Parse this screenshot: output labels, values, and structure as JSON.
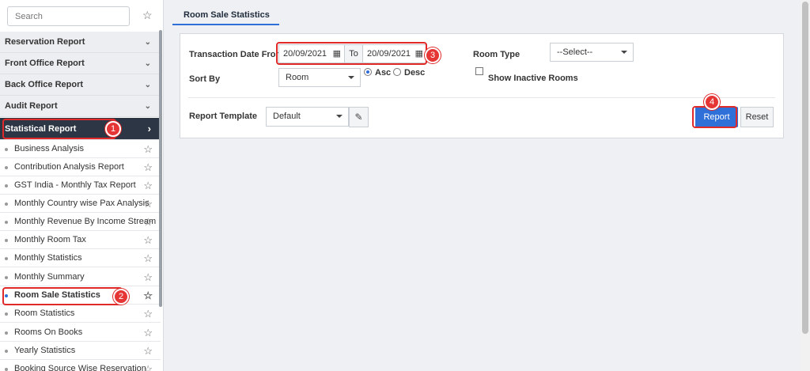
{
  "sidebar": {
    "search_placeholder": "Search",
    "categories": [
      {
        "label": "Reservation Report"
      },
      {
        "label": "Front Office Report"
      },
      {
        "label": "Back Office Report"
      },
      {
        "label": "Audit Report"
      },
      {
        "label": "Statistical Report",
        "active": true
      }
    ],
    "items": [
      {
        "label": "Business Analysis"
      },
      {
        "label": "Contribution Analysis Report"
      },
      {
        "label": "GST India - Monthly Tax Report"
      },
      {
        "label": "Monthly Country wise Pax Analysis"
      },
      {
        "label": "Monthly Revenue By Income Stream"
      },
      {
        "label": "Monthly Room Tax"
      },
      {
        "label": "Monthly Statistics"
      },
      {
        "label": "Monthly Summary"
      },
      {
        "label": "Room Sale Statistics",
        "current": true
      },
      {
        "label": "Room Statistics"
      },
      {
        "label": "Rooms On Books"
      },
      {
        "label": "Yearly Statistics"
      },
      {
        "label": "Booking Source Wise Reservation"
      }
    ]
  },
  "tab": {
    "label": "Room Sale Statistics"
  },
  "form": {
    "transaction_date_label": "Transaction Date From",
    "from_date": "20/09/2021",
    "to_label": "To",
    "to_date": "20/09/2021",
    "room_type_label": "Room Type",
    "room_type_value": "--Select--",
    "sort_by_label": "Sort By",
    "sort_by_value": "Room",
    "asc_label": "Asc",
    "desc_label": "Desc",
    "show_inactive_label": "Show Inactive Rooms",
    "report_template_label": "Report Template",
    "report_template_value": "Default",
    "report_button": "Report",
    "reset_button": "Reset"
  },
  "annotations": [
    "1",
    "2",
    "3",
    "4"
  ],
  "colors": {
    "accent": "#2e6fd8",
    "active_category_bg": "#2d3644",
    "annotation": "#e02a2a"
  }
}
